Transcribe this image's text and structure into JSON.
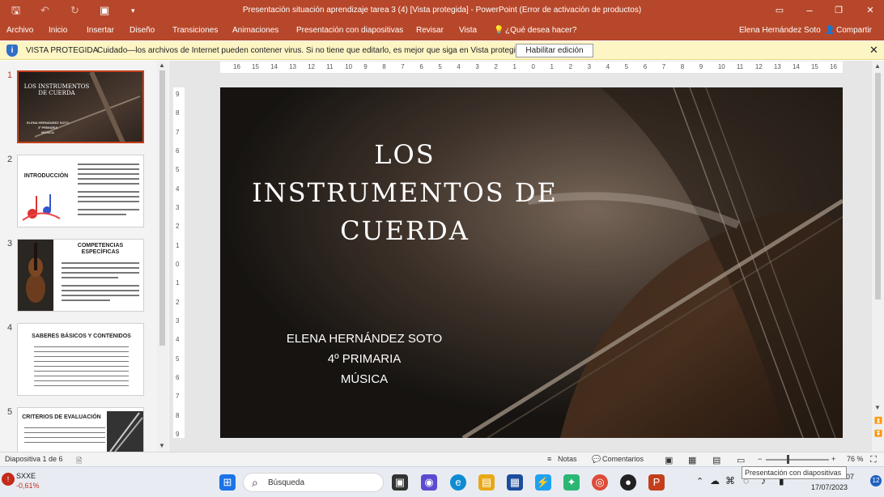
{
  "title_bar": {
    "title": "Presentación situación aprendizaje tarea 3 (4) [Vista protegida] - PowerPoint (Error de activación de productos)",
    "save_icon": "save-icon",
    "undo_icon": "undo-icon",
    "redo_icon": "redo-icon",
    "present_icon": "present-from-start-icon",
    "customize_icon": "customize-quick-access-icon",
    "minimize": "–",
    "restore": "❐",
    "close": "✕"
  },
  "menu": {
    "items": [
      "Archivo",
      "Inicio",
      "Insertar",
      "Diseño",
      "Transiciones",
      "Animaciones",
      "Presentación con diapositivas",
      "Revisar",
      "Vista",
      "¿Qué desea hacer?"
    ],
    "user": "Elena Hernández Soto",
    "share": "Compartir"
  },
  "notice": {
    "label": "VISTA PROTEGIDA",
    "message": "Cuidado—los archivos de Internet pueden contener virus. Si no tiene que editarlo, es mejor que siga en Vista protegida.",
    "button": "Habilitar edición",
    "close": "✕"
  },
  "thumbnails": [
    {
      "number": "1",
      "title": "LOS INSTRUMENTOS DE CUERDA",
      "sub": "ELENA HERNÁNDEZ SOTO\n4º PRIMARIA\nMÚSICA"
    },
    {
      "number": "2",
      "title": "INTRODUCCIÓN"
    },
    {
      "number": "3",
      "title": "COMPETENCIAS ESPECÍFICAS"
    },
    {
      "number": "4",
      "title": "SABERES BÁSICOS Y CONTENIDOS"
    },
    {
      "number": "5",
      "title": "CRITERIOS DE EVALUACIÓN"
    }
  ],
  "ruler": {
    "horizontal": [
      "16",
      "15",
      "14",
      "13",
      "12",
      "11",
      "10",
      "9",
      "8",
      "7",
      "6",
      "5",
      "4",
      "3",
      "2",
      "1",
      "0",
      "1",
      "2",
      "3",
      "4",
      "5",
      "6",
      "7",
      "8",
      "9",
      "10",
      "11",
      "12",
      "13",
      "14",
      "15",
      "16"
    ],
    "vertical": [
      "9",
      "8",
      "7",
      "6",
      "5",
      "4",
      "3",
      "2",
      "1",
      "0",
      "1",
      "2",
      "3",
      "4",
      "5",
      "6",
      "7",
      "8",
      "9"
    ]
  },
  "slide": {
    "title": "LOS\nINSTRUMENTOS DE\nCUERDA",
    "line1": "ELENA HERNÁNDEZ SOTO",
    "line2": "4º PRIMARIA",
    "line3": "MÚSICA"
  },
  "status": {
    "slide_count": "Diapositiva 1 de 6",
    "notes": "Notas",
    "comments": "Comentarios",
    "zoom": "76 %",
    "tooltip": "Presentación con diapositivas"
  },
  "taskbar": {
    "stock_ticker": "SXXE",
    "stock_change": "-0,61%",
    "search_placeholder": "Búsqueda",
    "date": "17/07/2023",
    "time_fragment": "07",
    "notifications": "12"
  }
}
